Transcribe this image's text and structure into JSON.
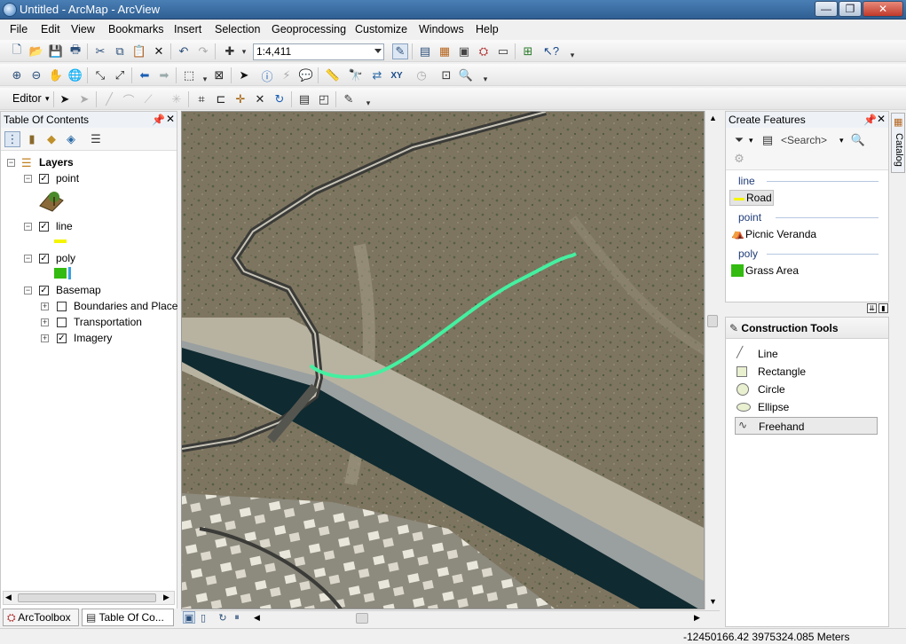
{
  "window": {
    "title": "Untitled - ArcMap - ArcView",
    "min": "—",
    "max": "❐",
    "close": "✕"
  },
  "menu": [
    "File",
    "Edit",
    "View",
    "Bookmarks",
    "Insert",
    "Selection",
    "Geoprocessing",
    "Customize",
    "Windows",
    "Help"
  ],
  "toolbar": {
    "scale": "1:4,411",
    "editor_label": "Editor"
  },
  "toc": {
    "title": "Table Of Contents",
    "root": "Layers",
    "layers": [
      {
        "name": "point",
        "checked": true
      },
      {
        "name": "line",
        "checked": true
      },
      {
        "name": "poly",
        "checked": true
      },
      {
        "name": "Basemap",
        "checked": true
      }
    ],
    "basemap_children": [
      {
        "name": "Boundaries and Place",
        "checked": false
      },
      {
        "name": "Transportation",
        "checked": false
      },
      {
        "name": "Imagery",
        "checked": true
      }
    ]
  },
  "bottom_tabs": {
    "arctoolbox": "ArcToolbox",
    "toc": "Table Of Co..."
  },
  "create_features": {
    "title": "Create Features",
    "search_placeholder": "<Search>",
    "groups": [
      {
        "name": "line",
        "item": "Road"
      },
      {
        "name": "point",
        "item": "Picnic Veranda"
      },
      {
        "name": "poly",
        "item": "Grass Area"
      }
    ]
  },
  "construction_tools": {
    "title": "Construction Tools",
    "items": [
      "Line",
      "Rectangle",
      "Circle",
      "Ellipse",
      "Freehand"
    ],
    "selected": "Freehand"
  },
  "catalog_tab": "Catalog",
  "status": {
    "coordinates": "-12450166.42  3975324.085 Meters"
  },
  "colors": {
    "title_bar": "#2f5f93",
    "road_symbol": "#f5f500",
    "grass_symbol": "#33bb11",
    "freehand_line": "#44f0a0"
  }
}
